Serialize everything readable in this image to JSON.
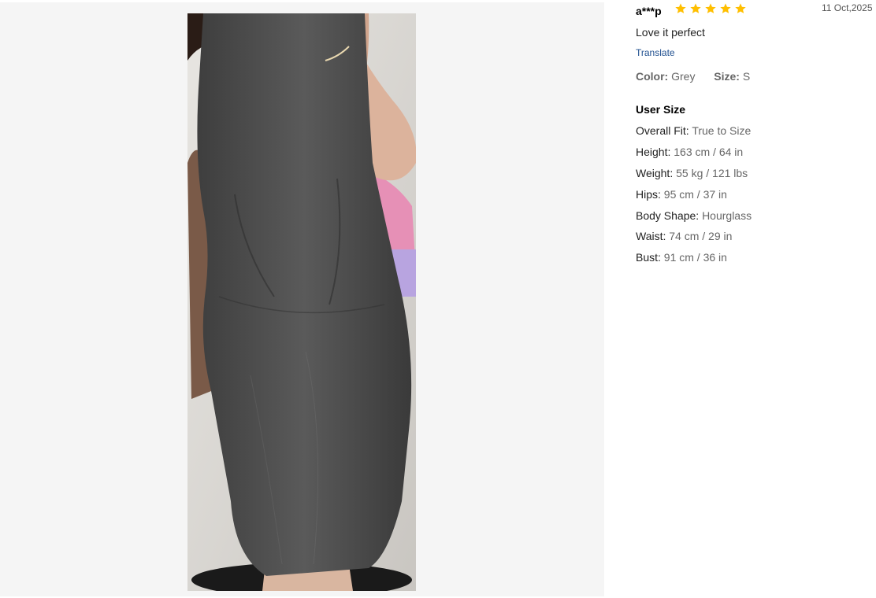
{
  "photo": {
    "alt": "Customer photo of grey sleeveless midi dress"
  },
  "review": {
    "reviewer": "a***p",
    "rating": 5,
    "rating_max": 5,
    "star_color": "#ffbf00",
    "date": "11 Oct,2025",
    "comment": "Love it perfect",
    "translate_label": "Translate",
    "color_label": "Color:",
    "color_value": "Grey",
    "size_label": "Size:",
    "size_value": "S"
  },
  "user_size": {
    "title": "User Size",
    "rows": [
      {
        "label": "Overall Fit:",
        "value": "True to Size"
      },
      {
        "label": "Height:",
        "value": "163 cm / 64 in"
      },
      {
        "label": "Weight:",
        "value": "55 kg / 121 lbs"
      },
      {
        "label": "Hips:",
        "value": "95 cm / 37 in"
      },
      {
        "label": "Body Shape:",
        "value": "Hourglass"
      },
      {
        "label": "Waist:",
        "value": "74 cm / 29 in"
      },
      {
        "label": "Bust:",
        "value": "91 cm / 36 in"
      }
    ]
  }
}
